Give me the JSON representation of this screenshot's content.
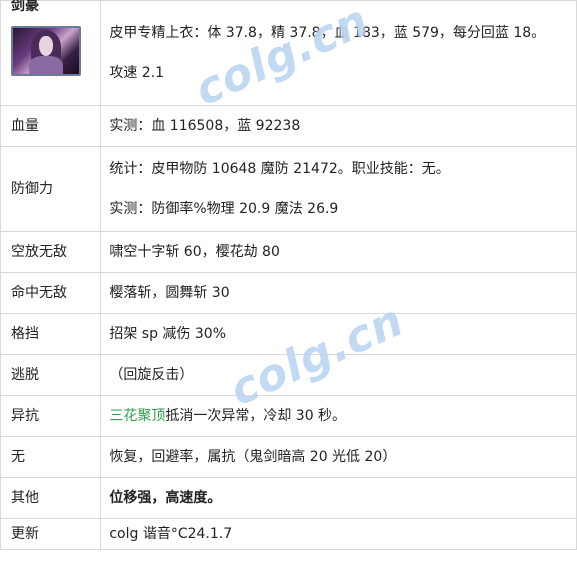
{
  "rows": [
    {
      "label": "剑豪",
      "lines": [
        "皮甲专精上衣：体 37.8，精 37.8，血 183，蓝 579，每分回蓝 18。",
        "攻速 2.1"
      ]
    },
    {
      "label": "血量",
      "value": "实测：血 116508，蓝 92238"
    },
    {
      "label": "防御力",
      "lines": [
        "统计：皮甲物防 10648 魔防 21472。职业技能：无。",
        "实测：防御率%物理 20.9 魔法 26.9"
      ]
    },
    {
      "label": "空放无敌",
      "value": "啸空十字斩 60，樱花劫 80"
    },
    {
      "label": "命中无敌",
      "value": "樱落斩，圆舞斩 30"
    },
    {
      "label": "格挡",
      "value": "招架 sp 减伤 30%"
    },
    {
      "label": "逃脱",
      "value": "（回旋反击）"
    },
    {
      "label": "异抗",
      "value_highlight": "三花聚顶",
      "value_rest": "抵消一次异常，冷却 30 秒。"
    },
    {
      "label": "无",
      "value": "恢复，回避率，属抗（鬼剑暗高 20 光低 20）"
    },
    {
      "label": "其他",
      "value": "位移强，高速度。"
    },
    {
      "label": "更新",
      "value": "colg 谐音°C24.1.7"
    }
  ],
  "portrait_icon": "character-portrait",
  "watermark": {
    "text": "colg.cn",
    "color": "#78aae6"
  },
  "colors": {
    "border": "#d9d9d9",
    "highlight": "#2e9e4a",
    "text": "#222222"
  }
}
